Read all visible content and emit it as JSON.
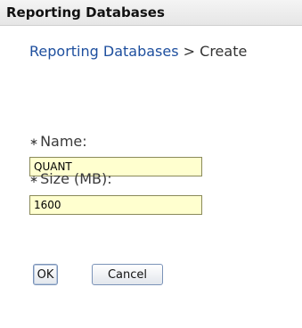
{
  "window": {
    "title": "Reporting Databases"
  },
  "breadcrumb": {
    "link": "Reporting Databases",
    "separator": ">",
    "current": "Create"
  },
  "form": {
    "required_marker": "∗",
    "name": {
      "label": "Name:",
      "value": "QUANT"
    },
    "size": {
      "label": "Size (MB):",
      "value": "1600"
    }
  },
  "buttons": {
    "ok_label": "OK",
    "cancel_label": "Cancel"
  },
  "colors": {
    "input_background": "#ffffcf",
    "link": "#1e4f9e"
  }
}
